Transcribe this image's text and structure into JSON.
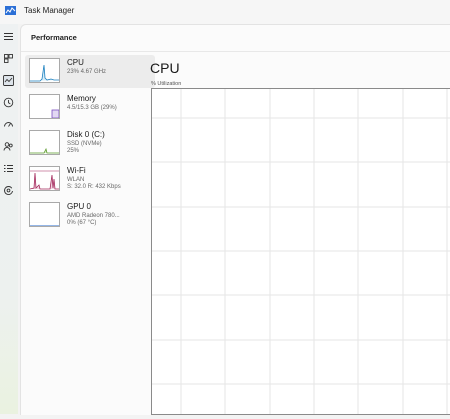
{
  "window": {
    "title": "Task Manager"
  },
  "rail": {
    "icons": [
      "hamburger-menu-icon",
      "processes-icon",
      "performance-icon",
      "app-history-icon",
      "startup-apps-icon",
      "users-icon",
      "details-icon",
      "services-icon"
    ]
  },
  "page": {
    "title": "Performance"
  },
  "devices": [
    {
      "name": "CPU",
      "sub1": "23% 4.67 GHz",
      "sub2": "",
      "sub3": ""
    },
    {
      "name": "Memory",
      "sub1": "4.5/15.3 GB (29%)",
      "sub2": "",
      "sub3": ""
    },
    {
      "name": "Disk 0 (C:)",
      "sub1": "SSD (NVMe)",
      "sub2": "25%",
      "sub3": ""
    },
    {
      "name": "Wi-Fi",
      "sub1": "WLAN",
      "sub2": "S: 32.0 R: 432 Kbps",
      "sub3": ""
    },
    {
      "name": "GPU 0",
      "sub1": "AMD Radeon 780...",
      "sub2": "0% (67 °C)",
      "sub3": ""
    }
  ],
  "main": {
    "title": "CPU",
    "subtitle": "% Utilization"
  },
  "colors": {
    "cpu": "#1a7fbf",
    "memory": "#7a4fbf",
    "disk": "#5a9a2a",
    "wifi": "#a3265a",
    "gpu": "#2a6fd0"
  }
}
